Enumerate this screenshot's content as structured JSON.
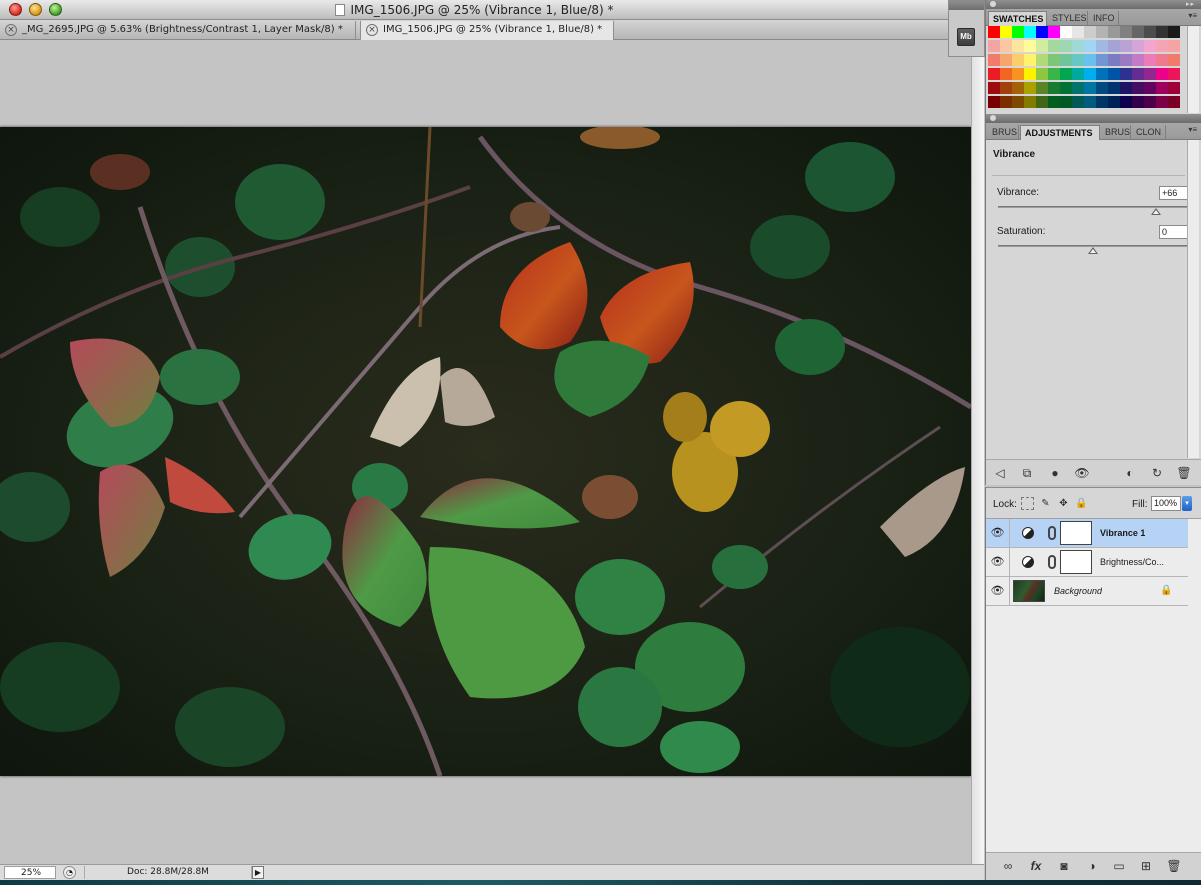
{
  "window": {
    "title": "IMG_1506.JPG @ 25% (Vibrance 1, Blue/8) *"
  },
  "tabs": [
    {
      "label": "_MG_2695.JPG @ 5.63% (Brightness/Contrast 1, Layer Mask/8) *",
      "active": false
    },
    {
      "label": "IMG_1506.JPG @ 25% (Vibrance 1, Blue/8) *",
      "active": true
    }
  ],
  "mini_dock": {
    "bridge_label": "Mb"
  },
  "status": {
    "zoom": "25%",
    "doc_info": "Doc: 28.8M/28.8M"
  },
  "swatches_panel": {
    "tabs": [
      "SWATCHES",
      "STYLES",
      "INFO"
    ],
    "rows": [
      [
        "#ff0000",
        "#ffff00",
        "#00ff00",
        "#00ffff",
        "#0000ff",
        "#ff00ff",
        "#ffffff",
        "#e6e6e6",
        "#cccccc",
        "#b3b3b3",
        "#999999",
        "#808080",
        "#666666",
        "#4d4d4d",
        "#333333",
        "#1a1a1a"
      ],
      [
        "#f5a3a3",
        "#fbc7a0",
        "#fde59e",
        "#fefb9c",
        "#d1eb9f",
        "#a4d89e",
        "#9fd6b4",
        "#9ed9d6",
        "#a0d6f3",
        "#a3b8e0",
        "#a5a3d5",
        "#b9a3d6",
        "#d5a4d8",
        "#f3a5cf",
        "#f4a4b3",
        "#f5a3a3"
      ],
      [
        "#f07b6c",
        "#f7a56d",
        "#fbce6c",
        "#fff26c",
        "#b3d977",
        "#7dc577",
        "#6fc49b",
        "#66c8c6",
        "#6ac0ec",
        "#7296d1",
        "#7b7bc1",
        "#9a7bc3",
        "#c27bc7",
        "#ee7bb9",
        "#ef7a8f",
        "#f07b6c"
      ],
      [
        "#ed1c24",
        "#f26522",
        "#f7941d",
        "#fff200",
        "#8dc63f",
        "#39b54a",
        "#00a651",
        "#00a99d",
        "#00aeef",
        "#0072bc",
        "#0054a6",
        "#2e3192",
        "#662d91",
        "#92278f",
        "#ec008c",
        "#ed145b"
      ],
      [
        "#9e0b0f",
        "#a0410d",
        "#a36209",
        "#aba000",
        "#598527",
        "#197b30",
        "#007236",
        "#00746b",
        "#0076a3",
        "#004a80",
        "#003471",
        "#1b1464",
        "#440e62",
        "#630460",
        "#9e005d",
        "#9e0039"
      ],
      [
        "#790000",
        "#7b2e00",
        "#7d4900",
        "#827b00",
        "#406618",
        "#005e20",
        "#005826",
        "#005952",
        "#005b7f",
        "#003663",
        "#002157",
        "#0d004c",
        "#32004b",
        "#4b0049",
        "#7b0046",
        "#7a0026"
      ]
    ]
  },
  "adjustments_panel": {
    "tabs": [
      "BRUS",
      "ADJUSTMENTS",
      "BRUS",
      "CLON"
    ],
    "heading": "Vibrance",
    "vibrance": {
      "label": "Vibrance:",
      "value": "+66",
      "slider_fraction": 0.83
    },
    "saturation": {
      "label": "Saturation:",
      "value": "0",
      "slider_fraction": 0.5
    },
    "footer_icons": [
      "back-arrow-icon",
      "expand-view-icon",
      "clip-to-layer-icon",
      "visibility-icon",
      "view-previous-icon",
      "reset-icon",
      "trash-icon"
    ]
  },
  "layers_panel": {
    "lock_label": "Lock:",
    "fill_label": "Fill:",
    "fill_value": "100%",
    "layers": [
      {
        "name": "Vibrance 1",
        "type": "adjustment",
        "selected": true
      },
      {
        "name": "Brightness/Co...",
        "type": "adjustment",
        "selected": false
      },
      {
        "name": "Background",
        "type": "background",
        "selected": false
      }
    ],
    "footer_icons": [
      "link-layers-icon",
      "fx-icon",
      "add-mask-icon",
      "new-adjustment-icon",
      "new-group-icon",
      "new-layer-icon",
      "delete-layer-icon"
    ]
  }
}
